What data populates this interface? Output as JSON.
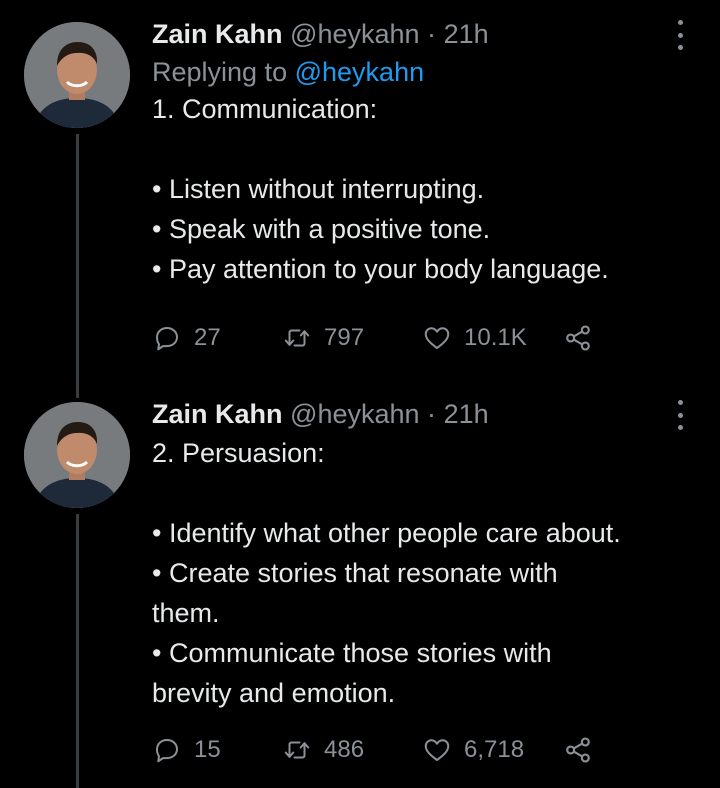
{
  "tweets": [
    {
      "author_name": "Zain Kahn",
      "handle": "@heykahn",
      "separator": "·",
      "time": "21h",
      "replying_prefix": "Replying to",
      "replying_to": "@heykahn",
      "lines": [
        "1. Communication:",
        "",
        "• Listen without interrupting.",
        "• Speak with a positive tone.",
        "• Pay attention to your body language."
      ],
      "replies": "27",
      "retweets": "797",
      "likes": "10.1K"
    },
    {
      "author_name": "Zain Kahn",
      "handle": "@heykahn",
      "separator": "·",
      "time": "21h",
      "lines": [
        "2. Persuasion:",
        "",
        "• Identify what other people care about.",
        "• Create stories that resonate with",
        "them.",
        "• Communicate those stories with",
        "brevity and emotion."
      ],
      "replies": "15",
      "retweets": "486",
      "likes": "6,718"
    }
  ],
  "icons": [
    "reply-icon",
    "retweet-icon",
    "like-icon",
    "share-icon",
    "more-icon"
  ],
  "colors": {
    "background": "#000000",
    "text": "#e7e9ea",
    "muted": "#8b9196",
    "link": "#1d9bf0"
  }
}
